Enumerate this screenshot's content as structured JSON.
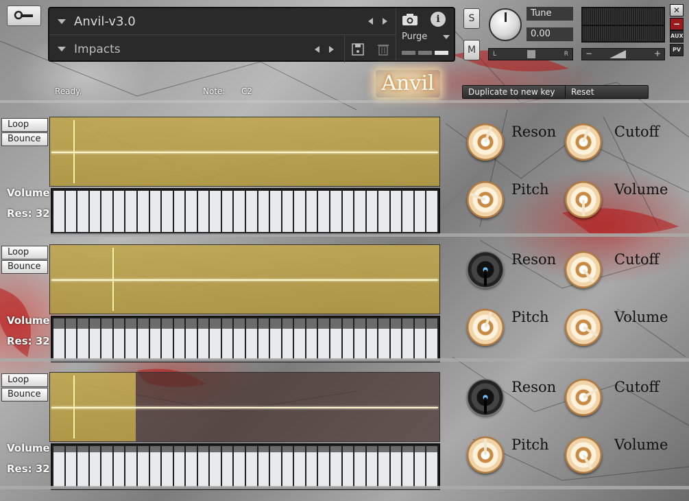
{
  "header": {
    "instrument_name": "Anvil-v3.0",
    "preset_name": "Impacts",
    "purge_label": "Purge",
    "solo_label": "S",
    "mute_label": "M",
    "tune_label": "Tune",
    "tune_value": "0.00",
    "pan_left": "L",
    "pan_right": "R",
    "vol_minus": "−",
    "vol_plus": "+",
    "aux_label": "AUX",
    "pv_label": "PV",
    "close_label": "✕",
    "minimize_label": "−"
  },
  "status": {
    "ready": "Ready.",
    "note_label": "Note:",
    "note_value": "C2"
  },
  "logo": "Anvil",
  "actions": {
    "duplicate": "Duplicate to new key",
    "reset": "Reset"
  },
  "layers": [
    {
      "loop": "Loop",
      "bounce": "Bounce",
      "volume_label": "Volume",
      "res_label": "Res: 32",
      "wave_fill_fraction": 1.0,
      "cursor_fraction": 0.06,
      "knobs": {
        "reson": "Reson",
        "pitch": "Pitch",
        "cutoff": "Cutoff",
        "volume": "Volume"
      },
      "knob_angles": {
        "reson": 200,
        "pitch": 110,
        "cutoff": 200,
        "volume": 0
      },
      "reson_dark": false,
      "step_tops": [
        0,
        0,
        0,
        0,
        0,
        0,
        0,
        0,
        0,
        0,
        0,
        0,
        0,
        0,
        0,
        0,
        0,
        0,
        0,
        0,
        0,
        0,
        0,
        0,
        0,
        0,
        0,
        0,
        0,
        0,
        0,
        0
      ]
    },
    {
      "loop": "Loop",
      "bounce": "Bounce",
      "volume_label": "Volume",
      "res_label": "Res: 32",
      "wave_fill_fraction": 1.0,
      "cursor_fraction": 0.16,
      "knobs": {
        "reson": "Reson",
        "pitch": "Pitch",
        "cutoff": "Cutoff",
        "volume": "Volume"
      },
      "knob_angles": {
        "reson": 0,
        "pitch": 200,
        "cutoff": 320,
        "volume": 300
      },
      "reson_dark": true,
      "step_tops": [
        0.25,
        0.25,
        0.25,
        0.25,
        0.25,
        0.25,
        0.25,
        0.25,
        0.25,
        0.25,
        0.25,
        0.25,
        0.25,
        0.25,
        0.25,
        0.25,
        0.25,
        0.25,
        0.25,
        0.25,
        0.25,
        0.25,
        0.25,
        0.25,
        0.25,
        0.25,
        0.25,
        0.25,
        0.25,
        0.25,
        0.25,
        0.25
      ]
    },
    {
      "loop": "Loop",
      "bounce": "Bounce",
      "volume_label": "Volume",
      "res_label": "Res: 32",
      "wave_fill_fraction": 0.22,
      "cursor_fraction": 0.06,
      "knobs": {
        "reson": "Reson",
        "pitch": "Pitch",
        "cutoff": "Cutoff",
        "volume": "Volume"
      },
      "knob_angles": {
        "reson": 0,
        "pitch": 180,
        "cutoff": 240,
        "volume": 330
      },
      "reson_dark": true,
      "step_tops": [
        0.15,
        0.15,
        0.15,
        0.15,
        0.15,
        0.15,
        0.15,
        0.15,
        0.15,
        0.15,
        0.15,
        0.15,
        0.15,
        0.15,
        0.15,
        0.15,
        0.15,
        0.15,
        0.15,
        0.15,
        0.15,
        0.15,
        0.15,
        0.15,
        0.15,
        0.15,
        0.15,
        0.15,
        0.15,
        0.15,
        0.15,
        0.15
      ]
    }
  ]
}
